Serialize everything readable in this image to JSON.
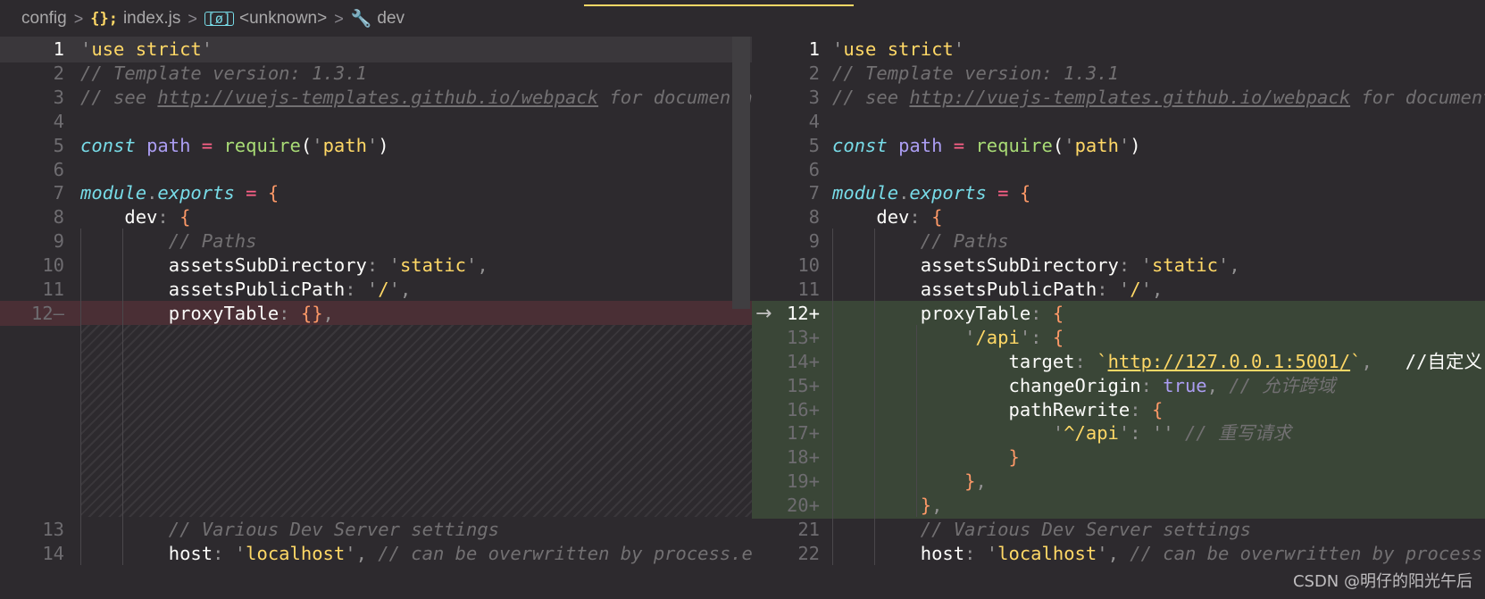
{
  "breadcrumb": {
    "items": [
      {
        "label": "config",
        "icon": null
      },
      {
        "label": "index.js",
        "icon": "js-file-icon",
        "icon_glyph": "{};"
      },
      {
        "label": "<unknown>",
        "icon": "field-icon",
        "icon_glyph": "[ø]"
      },
      {
        "label": "dev",
        "icon": "wrench-icon",
        "icon_glyph": "🔧"
      }
    ],
    "separator": ">"
  },
  "colors": {
    "background": "#2d2a2e",
    "removed": "#4a2f35",
    "added": "#3a4637",
    "tab_indicator": "#ffd866"
  },
  "left_lines": [
    {
      "num": "1",
      "text": "'use strict'"
    },
    {
      "num": "2",
      "text": "// Template version: 1.3.1"
    },
    {
      "num": "3",
      "text": "// see http://vuejs-templates.github.io/webpack for documenta"
    },
    {
      "num": "4",
      "text": ""
    },
    {
      "num": "5",
      "text": "const path = require('path')"
    },
    {
      "num": "6",
      "text": ""
    },
    {
      "num": "7",
      "text": "module.exports = {"
    },
    {
      "num": "8",
      "text": "    dev: {"
    },
    {
      "num": "9",
      "text": "        // Paths"
    },
    {
      "num": "10",
      "text": "        assetsSubDirectory: 'static',"
    },
    {
      "num": "11",
      "text": "        assetsPublicPath: '/',"
    },
    {
      "num": "12—",
      "text": "        proxyTable: {},"
    },
    {
      "num": "13",
      "text": "        // Various Dev Server settings"
    },
    {
      "num": "14",
      "text": "        host: 'localhost', // can be overwritten by process.e"
    }
  ],
  "right_lines": [
    {
      "num": "1",
      "text": "'use strict'"
    },
    {
      "num": "2",
      "text": "// Template version: 1.3.1"
    },
    {
      "num": "3",
      "text": "// see http://vuejs-templates.github.io/webpack for document"
    },
    {
      "num": "4",
      "text": ""
    },
    {
      "num": "5",
      "text": "const path = require('path')"
    },
    {
      "num": "6",
      "text": ""
    },
    {
      "num": "7",
      "text": "module.exports = {"
    },
    {
      "num": "8",
      "text": "    dev: {"
    },
    {
      "num": "9",
      "text": "        // Paths"
    },
    {
      "num": "10",
      "text": "        assetsSubDirectory: 'static',"
    },
    {
      "num": "11",
      "text": "        assetsPublicPath: '/',"
    },
    {
      "num": "12+",
      "text": "        proxyTable: {"
    },
    {
      "num": "13+",
      "text": "            '/api': {"
    },
    {
      "num": "14+",
      "text": "                target: `http://127.0.0.1:5001/`,   //自定义"
    },
    {
      "num": "15+",
      "text": "                changeOrigin: true, // 允许跨域"
    },
    {
      "num": "16+",
      "text": "                pathRewrite: {"
    },
    {
      "num": "17+",
      "text": "                    '^/api': '' // 重写请求"
    },
    {
      "num": "18+",
      "text": "                }"
    },
    {
      "num": "19+",
      "text": "            },"
    },
    {
      "num": "20+",
      "text": "        },"
    },
    {
      "num": "21",
      "text": "        // Various Dev Server settings"
    },
    {
      "num": "22",
      "text": "        host: 'localhost', // can be overwritten by process.e"
    }
  ],
  "diff_arrow": "→",
  "watermark": "CSDN @明仔的阳光午后"
}
